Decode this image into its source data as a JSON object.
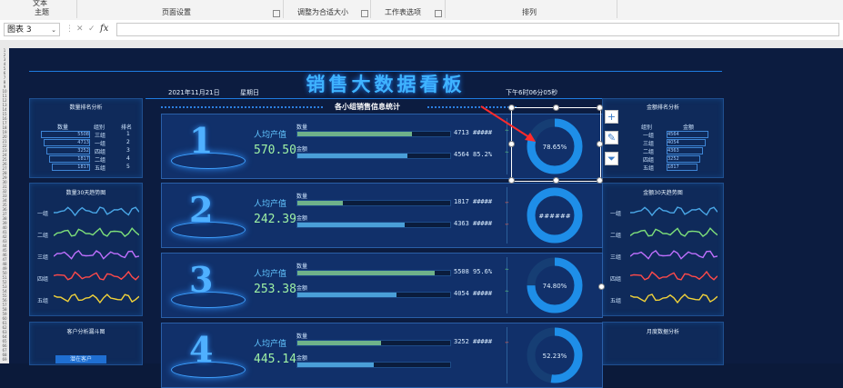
{
  "ribbon": {
    "top_item": "文本",
    "groups": [
      "主题",
      "页面设置",
      "调整为合适大小",
      "工作表选项",
      "排列"
    ]
  },
  "formula_bar": {
    "name_box": "图表 3",
    "cancel_symbol": "✕",
    "enter_symbol": "✓",
    "fx_symbol": "fx",
    "formula_value": ""
  },
  "dashboard": {
    "title": "销售大数据看板",
    "date": "2021年11月21日",
    "weekday": "星期日",
    "time": "下午6时06分05秒",
    "section_title": "各小组销售信息统计",
    "left_rank": {
      "title": "数量排名分析",
      "headers": [
        "数量",
        "组别",
        "排名"
      ],
      "rows": [
        {
          "value": "5508",
          "group": "三组",
          "rank": "1"
        },
        {
          "value": "4713",
          "group": "一组",
          "rank": "2"
        },
        {
          "value": "3252",
          "group": "四组",
          "rank": "3"
        },
        {
          "value": "1817",
          "group": "二组",
          "rank": "4"
        },
        {
          "value": "1817",
          "group": "五组",
          "rank": "5"
        }
      ]
    },
    "right_rank": {
      "title": "金额排名分析",
      "headers": [
        "组别",
        "金额"
      ],
      "rows": [
        {
          "group": "一组",
          "value": "4564"
        },
        {
          "group": "三组",
          "value": "4054"
        },
        {
          "group": "二组",
          "value": "4363"
        },
        {
          "group": "四组",
          "value": "3252"
        },
        {
          "group": "五组",
          "value": "1817"
        }
      ]
    },
    "left_trend": {
      "title": "数量30天趋势图",
      "labels": [
        "一组",
        "二组",
        "三组",
        "四组",
        "五组"
      ],
      "colors": [
        "#4aa8e8",
        "#7ee07a",
        "#c070ff",
        "#ff4a4a",
        "#f2d33a"
      ]
    },
    "right_trend": {
      "title": "金额30天趋势图",
      "labels": [
        "一组",
        "二组",
        "三组",
        "四组",
        "五组"
      ],
      "colors": [
        "#4aa8e8",
        "#7ee07a",
        "#c070ff",
        "#ff4a4a",
        "#f2d33a"
      ]
    },
    "left_funnel": {
      "title": "客户分析漏斗图",
      "label": "潜在客户"
    },
    "right_month": {
      "title": "月度数据分析"
    },
    "groups": [
      {
        "rank": "1",
        "label": "人均产值",
        "value": "570.50",
        "qty_label": "数量",
        "qty": "4713",
        "qty_pct": "#####",
        "qty_fill": 0.75,
        "amt_label": "金额",
        "amt": "4564",
        "amt_pct": "85.2%",
        "amt_fill": 0.72,
        "qty_arrow": "↑",
        "qty_arrow_color": "#62d36a",
        "amt_arrow": "↑",
        "amt_arrow_color": "#62d36a",
        "ring": "78.65%",
        "ring_fill": 0.7865
      },
      {
        "rank": "2",
        "label": "人均产值",
        "value": "242.39",
        "qty_label": "数量",
        "qty": "1817",
        "qty_pct": "#####",
        "qty_fill": 0.3,
        "amt_label": "金额",
        "amt": "4363",
        "amt_pct": "#####",
        "amt_fill": 0.7,
        "qty_arrow": "↓",
        "qty_arrow_color": "#ff5a3a",
        "amt_arrow": "↓",
        "amt_arrow_color": "#ff5a3a",
        "ring": "######",
        "ring_fill": 1.0
      },
      {
        "rank": "3",
        "label": "人均产值",
        "value": "253.38",
        "qty_label": "数量",
        "qty": "5508",
        "qty_pct": "95.6%",
        "qty_fill": 0.9,
        "amt_label": "金额",
        "amt": "4054",
        "amt_pct": "#####",
        "amt_fill": 0.65,
        "qty_arrow": "↑",
        "qty_arrow_color": "#62d36a",
        "amt_arrow": "↑",
        "amt_arrow_color": "#62d36a",
        "ring": "74.80%",
        "ring_fill": 0.748
      },
      {
        "rank": "4",
        "label": "人均产值",
        "value": "445.14",
        "qty_label": "数量",
        "qty": "3252",
        "qty_pct": "#####",
        "qty_fill": 0.55,
        "amt_label": "金额",
        "amt": "",
        "amt_pct": "",
        "amt_fill": 0.5,
        "qty_arrow": "↓",
        "qty_arrow_color": "#ff5a3a",
        "amt_arrow": "",
        "amt_arrow_color": "#62d36a",
        "ring": "52.23%",
        "ring_fill": 0.5223
      }
    ]
  }
}
